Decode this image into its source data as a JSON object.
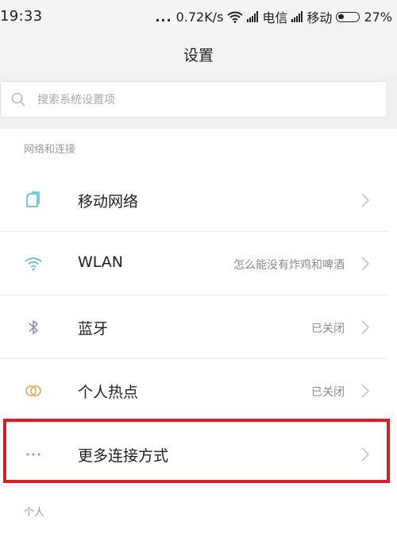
{
  "status_bar": {
    "time": "19:33",
    "dots": "...",
    "speed": "0.72K/s",
    "carrier_1": "电信",
    "carrier_2": "移动",
    "battery": "27%",
    "icons": [
      "wifi-icon",
      "signal-icon",
      "battery-icon"
    ]
  },
  "header": {
    "title": "设置"
  },
  "search": {
    "placeholder": "搜索系统设置项",
    "value": ""
  },
  "sections": [
    {
      "header": "网络和连接",
      "items": [
        {
          "label": "移动网络",
          "value": "",
          "icon": "sim-card-icon"
        },
        {
          "label": "WLAN",
          "value": "怎么能没有炸鸡和啤酒",
          "icon": "wifi-icon"
        },
        {
          "label": "蓝牙",
          "value": "已关闭",
          "icon": "bluetooth-icon"
        },
        {
          "label": "个人热点",
          "value": "已关闭",
          "icon": "hotspot-icon"
        },
        {
          "label": "更多连接方式",
          "value": "",
          "icon": "more-dots-icon"
        }
      ]
    },
    {
      "header": "个人",
      "items": []
    }
  ],
  "colors": {
    "accent": "#4bb8c4",
    "highlight_border": "#d4202a",
    "secondary_text": "#8a8a8a"
  }
}
